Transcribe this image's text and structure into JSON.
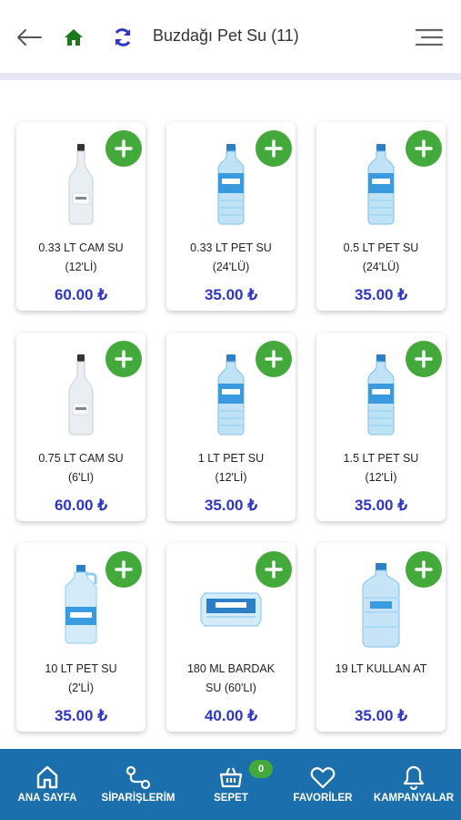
{
  "header": {
    "title": "Buzdağı Pet Su (11)",
    "icons": {
      "back": "arrow-left-icon",
      "home": "home-icon",
      "refresh": "refresh-icon",
      "menu": "hamburger-menu-icon"
    },
    "home_color": "#1a7a1a",
    "refresh_color": "#2e35c9"
  },
  "products": [
    {
      "name_line1": "0.33 LT CAM SU",
      "name_line2": "(12'Lİ)",
      "price": "60.00 ₺",
      "image": "glass-bottle"
    },
    {
      "name_line1": "0.33 LT PET SU",
      "name_line2": "(24'LÜ)",
      "price": "35.00 ₺",
      "image": "pet-bottle"
    },
    {
      "name_line1": "0.5 LT PET SU",
      "name_line2": "(24'LÜ)",
      "price": "35.00 ₺",
      "image": "pet-bottle"
    },
    {
      "name_line1": "0.75 LT CAM SU",
      "name_line2": "(6'LI)",
      "price": "60.00 ₺",
      "image": "glass-bottle"
    },
    {
      "name_line1": "1 LT PET SU",
      "name_line2": "(12'Lİ)",
      "price": "35.00 ₺",
      "image": "pet-bottle"
    },
    {
      "name_line1": "1.5 LT PET SU",
      "name_line2": "(12'Lİ)",
      "price": "35.00 ₺",
      "image": "pet-bottle"
    },
    {
      "name_line1": "10 LT PET SU",
      "name_line2": "(2'Lİ)",
      "price": "35.00 ₺",
      "image": "jug"
    },
    {
      "name_line1": "180 ML BARDAK",
      "name_line2": "SU (60'LI)",
      "price": "40.00 ₺",
      "image": "cup-pack"
    },
    {
      "name_line1": "19 LT KULLAN AT",
      "name_line2": "",
      "price": "35.00 ₺",
      "image": "big-jug"
    }
  ],
  "colors": {
    "accent_green": "#43a93a",
    "price_blue": "#2e35c9",
    "nav_blue": "#1c6fad"
  },
  "bottom_nav": {
    "items": [
      {
        "label": "ANA SAYFA",
        "icon": "home-outline-icon"
      },
      {
        "label": "SİPARİŞLERİM",
        "icon": "route-icon"
      },
      {
        "label": "SEPET",
        "icon": "basket-icon"
      },
      {
        "label": "FAVORİLER",
        "icon": "heart-icon"
      },
      {
        "label": "KAMPANYALAR",
        "icon": "bell-icon"
      }
    ],
    "cart_count": "0"
  }
}
